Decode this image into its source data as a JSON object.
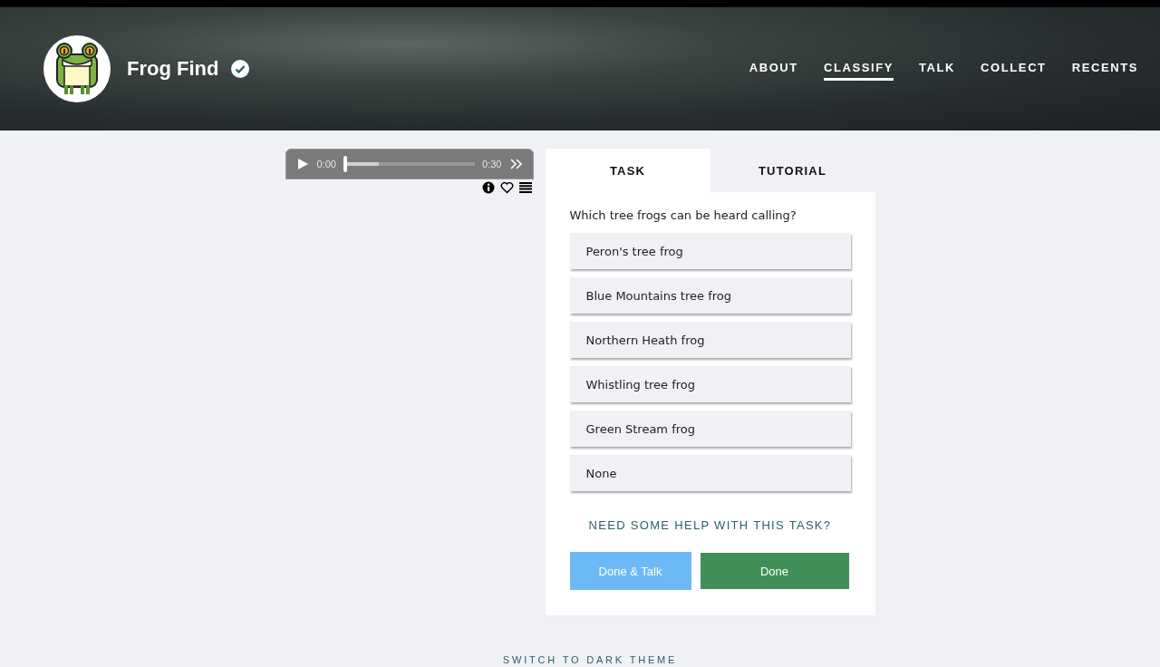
{
  "header": {
    "title": "Frog Find",
    "verified": true,
    "nav": [
      {
        "label": "ABOUT",
        "selected": false
      },
      {
        "label": "CLASSIFY",
        "selected": true
      },
      {
        "label": "TALK",
        "selected": false
      },
      {
        "label": "COLLECT",
        "selected": false
      },
      {
        "label": "RECENTS",
        "selected": false
      }
    ]
  },
  "player": {
    "current": "0:00",
    "duration": "0:30",
    "level": 0
  },
  "task_panel": {
    "tabs": [
      {
        "label": "TASK",
        "selected": true
      },
      {
        "label": "TUTORIAL",
        "selected": false
      }
    ],
    "question": "Which tree frogs can be heard calling?",
    "options": [
      {
        "label": "Peron's tree frog",
        "selected": false
      },
      {
        "label": "Blue Mountains tree frog",
        "selected": false
      },
      {
        "label": "Northern Heath frog",
        "selected": false
      },
      {
        "label": "Whistling tree frog",
        "selected": false
      },
      {
        "label": "Green Stream frog",
        "selected": false
      },
      {
        "label": "None",
        "selected": false
      }
    ],
    "help_link": "NEED SOME HELP WITH THIS TASK?",
    "buttons": [
      {
        "label": "Done & Talk",
        "kind": "talk"
      },
      {
        "label": "Done",
        "kind": "done"
      }
    ]
  },
  "theme_toggle": "SWITCH TO DARK THEME"
}
